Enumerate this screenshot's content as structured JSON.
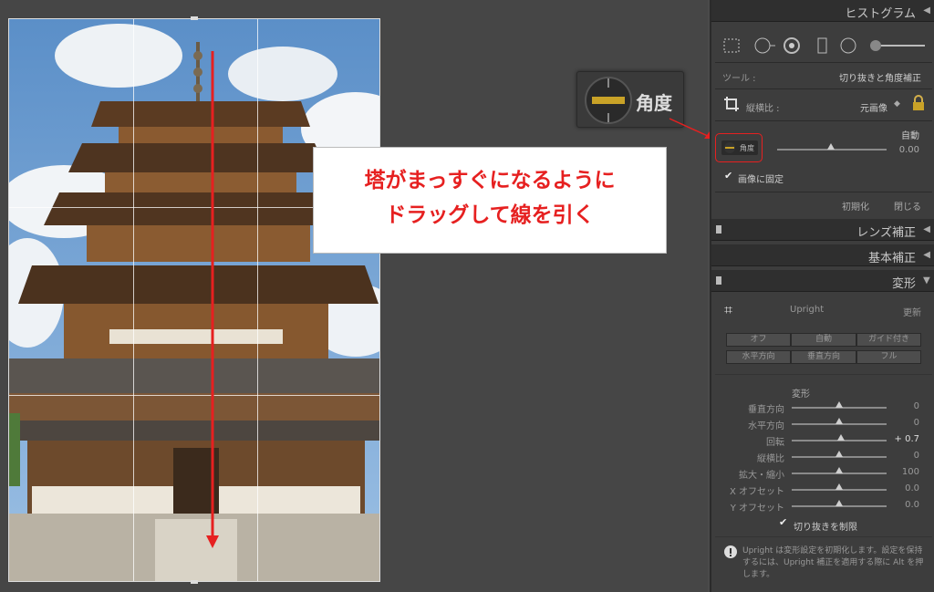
{
  "panel": {
    "histogram_title": "ヒストグラム",
    "tool_label": "ツール :",
    "tool_value": "切り抜きと角度補正",
    "aspect_label": "縦横比 :",
    "aspect_value": "元画像",
    "auto_label": "自動",
    "angle_button_label": "角度",
    "angle_value": "0.00",
    "lock_label": "画像に固定",
    "reset_label": "初期化",
    "close_label": "閉じる",
    "lens_title": "レンズ補正",
    "basic_title": "基本補正",
    "transform_title": "変形",
    "upright_label": "Upright",
    "update_label": "更新",
    "upright_buttons": [
      "オフ",
      "自動",
      "ガイド付き",
      "水平方向",
      "垂直方向",
      "フル"
    ],
    "transform_sub": "変形",
    "sliders": [
      {
        "label": "垂直方向",
        "value": "0"
      },
      {
        "label": "水平方向",
        "value": "0"
      },
      {
        "label": "回転",
        "value": "+ 0.7"
      },
      {
        "label": "縦横比",
        "value": "0"
      },
      {
        "label": "拡大・縮小",
        "value": "100"
      },
      {
        "label": "X オフセット",
        "value": "0.0"
      },
      {
        "label": "Y オフセット",
        "value": "0.0"
      }
    ],
    "constrain_label": "切り抜きを制限",
    "info_text": "Upright は変形設定を初期化します。設定を保持するには、Upright 補正を適用する際に Alt を押します。"
  },
  "callout": {
    "angle_label": "角度",
    "note_line1": "塔がまっすぐになるように",
    "note_line2": "ドラッグして線を引く"
  },
  "colors": {
    "accent_red": "#e62020"
  }
}
